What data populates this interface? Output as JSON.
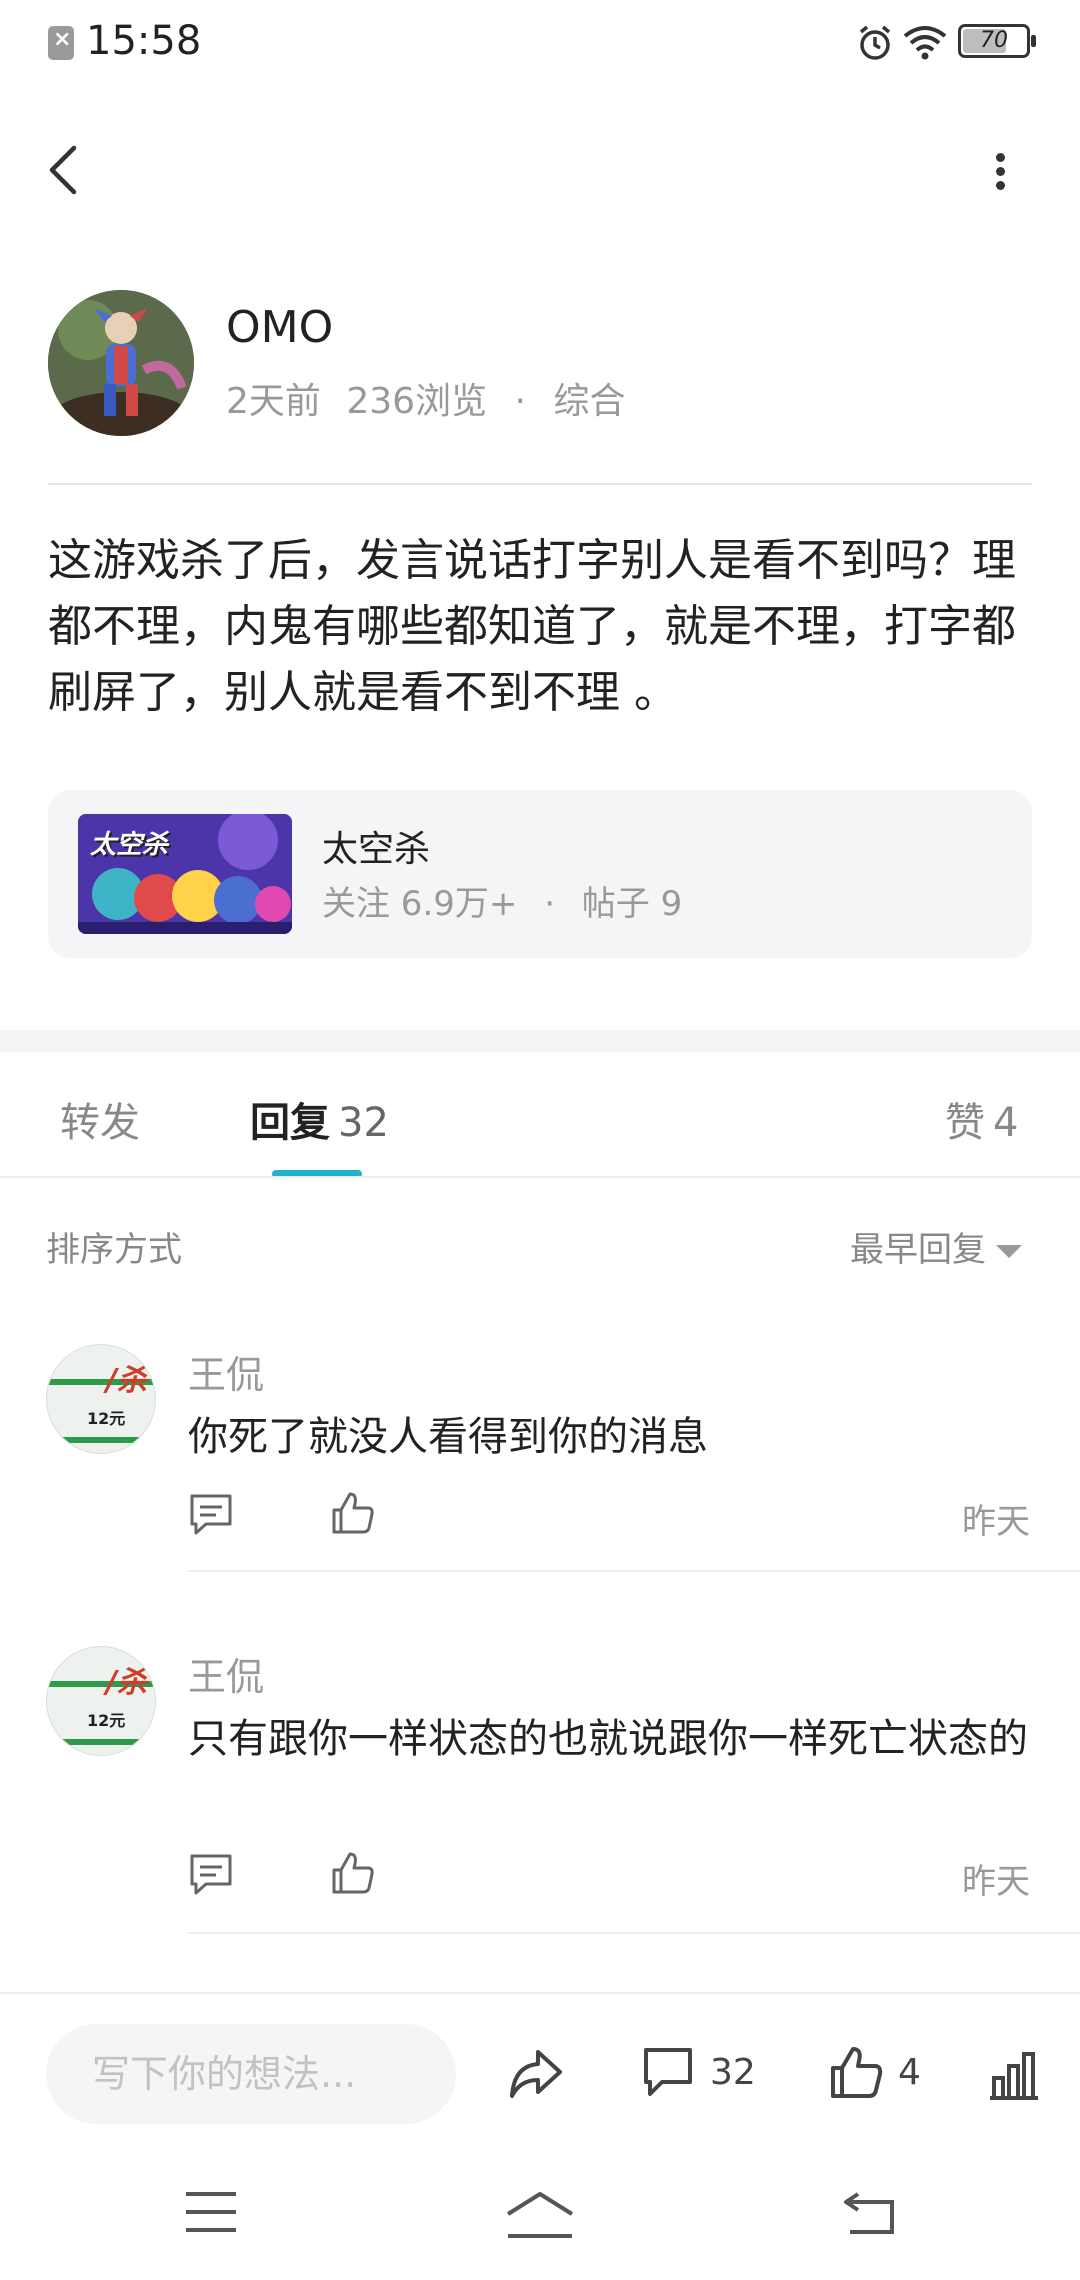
{
  "status_bar": {
    "time": "15:58",
    "battery": "70",
    "battery_level": 0.7
  },
  "post": {
    "author": "OMO",
    "time_ago": "2天前",
    "views": "236浏览",
    "separator": "·",
    "category": "综合",
    "body": "这游戏杀了后，发言说话打字别人是看不到吗？理都不理，内鬼有哪些都知道了，就是不理，打字都刷屏了，别人就是看不到不理 。"
  },
  "game_card": {
    "thumb_title": "太空杀",
    "name": "太空杀",
    "followers": "关注 6.9万+",
    "separator": "·",
    "posts": "帖子 9"
  },
  "tabs": {
    "forward": "转发",
    "reply": "回复",
    "reply_count": "32",
    "like": "赞",
    "like_count": "4"
  },
  "sort": {
    "label": "排序方式",
    "selected": "最早回复"
  },
  "comments": [
    {
      "author": "王侃",
      "text": "你死了就没人看得到你的消息",
      "time": "昨天"
    },
    {
      "author": "王侃",
      "text": "只有跟你一样状态的也就说跟你一样死亡状态的",
      "time": "昨天"
    }
  ],
  "comment_avatar_tag": "/杀",
  "comment_avatar_price": "12元",
  "action_bar": {
    "placeholder": "写下你的想法...",
    "comment_count": "32",
    "like_count": "4"
  },
  "colors": {
    "accent": "#22b3c8",
    "text": "#222222",
    "muted": "#999999"
  },
  "icons": [
    "back-icon",
    "more-icon",
    "alarm-icon",
    "wifi-icon",
    "battery-icon",
    "reply-icon",
    "like-icon",
    "share-icon",
    "comment-icon",
    "stats-icon",
    "menu-icon",
    "home-icon",
    "return-icon"
  ]
}
